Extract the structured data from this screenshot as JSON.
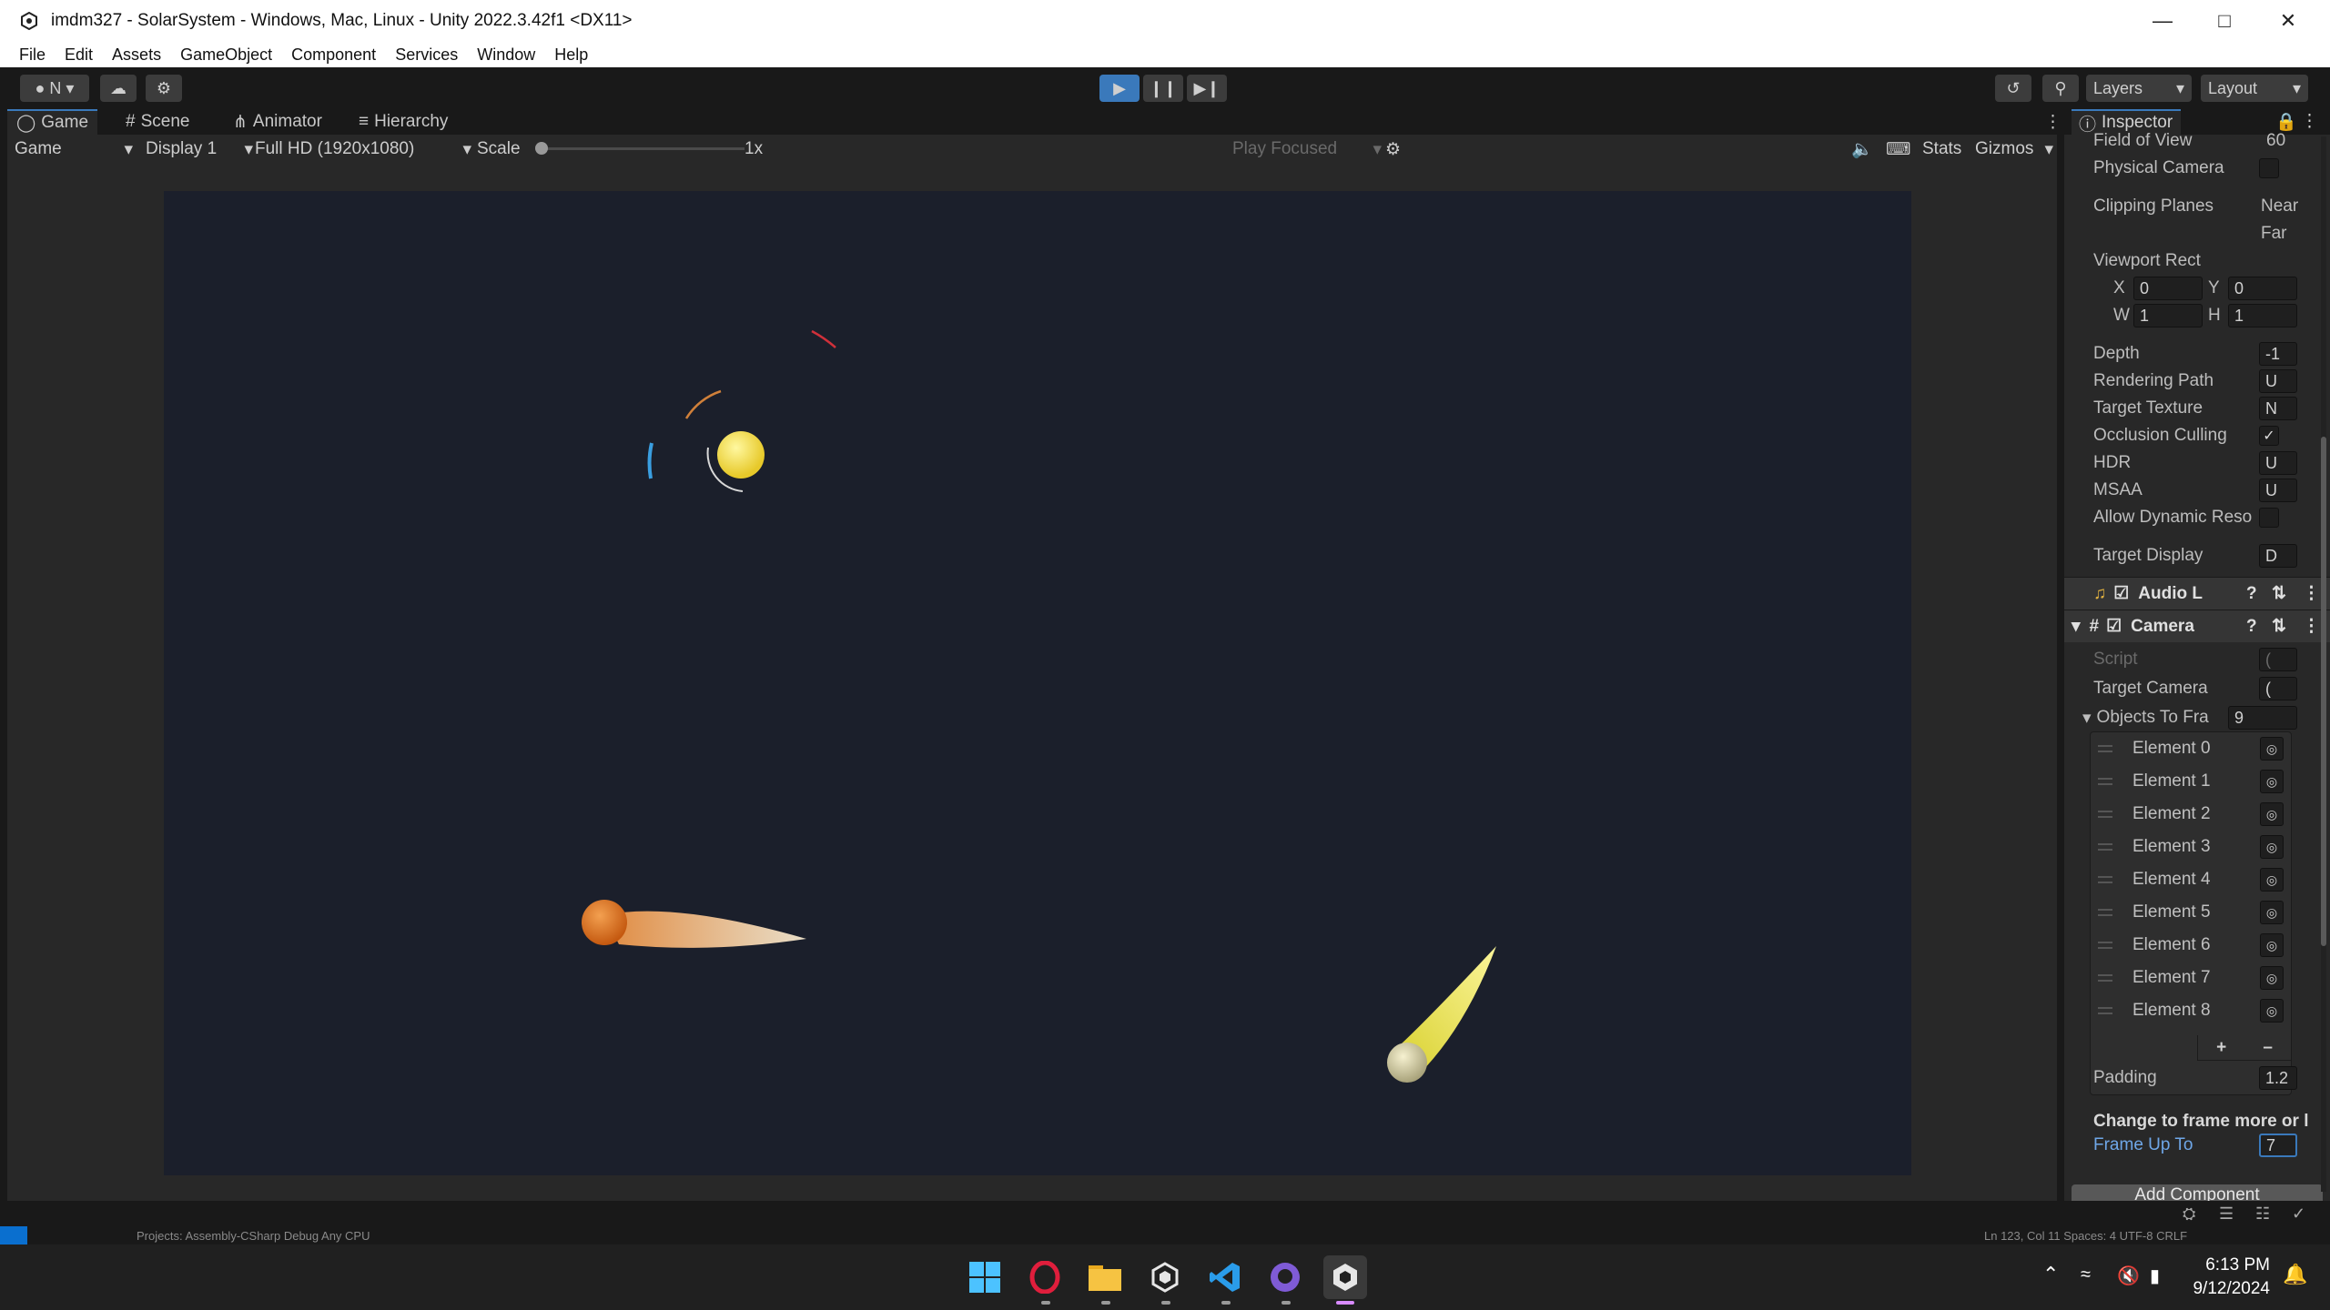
{
  "window": {
    "title": "imdm327 - SolarSystem - Windows, Mac, Linux - Unity 2022.3.42f1 <DX11>"
  },
  "menu": [
    "File",
    "Edit",
    "Assets",
    "GameObject",
    "Component",
    "Services",
    "Window",
    "Help"
  ],
  "toolbar": {
    "account": "N",
    "layers": "Layers",
    "layout": "Layout"
  },
  "tabs": {
    "game": "Game",
    "scene": "Scene",
    "animator": "Animator",
    "hierarchy": "Hierarchy",
    "inspector": "Inspector"
  },
  "gamebar": {
    "mode": "Game",
    "display": "Display 1",
    "resolution": "Full HD (1920x1080)",
    "scale_label": "Scale",
    "scale_value": "1x",
    "play_focused": "Play Focused",
    "stats": "Stats",
    "gizmos": "Gizmos"
  },
  "inspector": {
    "field_of_view_label": "Field of View",
    "field_of_view_value": "60",
    "physical_camera": "Physical Camera",
    "clipping_planes": "Clipping Planes",
    "near": "Near",
    "far": "Far",
    "viewport_rect": "Viewport Rect",
    "x_label": "X",
    "x_value": "0",
    "y_label": "Y",
    "y_value": "0",
    "w_label": "W",
    "w_value": "1",
    "h_label": "H",
    "h_value": "1",
    "depth": "Depth",
    "depth_value": "-1",
    "rendering_path": "Rendering Path",
    "rendering_path_value": "U",
    "target_texture": "Target Texture",
    "target_texture_value": "N",
    "occlusion_culling": "Occlusion Culling",
    "hdr": "HDR",
    "hdr_value": "U",
    "msaa": "MSAA",
    "msaa_value": "U",
    "allow_dynamic": "Allow Dynamic Reso",
    "target_display": "Target Display",
    "target_display_value": "D",
    "audio_component": "Audio L",
    "camera_component": "Camera",
    "script": "Script",
    "script_value": "(",
    "target_camera": "Target Camera",
    "target_camera_value": "(",
    "objects_to_frame": "Objects To Fra",
    "objects_count": "9",
    "elements": [
      "Element 0",
      "Element 1",
      "Element 2",
      "Element 3",
      "Element 4",
      "Element 5",
      "Element 6",
      "Element 7",
      "Element 8"
    ],
    "padding": "Padding",
    "padding_value": "1.2",
    "help_text": "Change to frame more or l",
    "frame_up_to": "Frame Up To",
    "frame_up_to_value": "7",
    "add_component": "Add Component"
  },
  "statusbar": {
    "text": "Projects: Assembly-CSharp   Debug Any CPU",
    "right": "Ln 123, Col 11   Spaces: 4   UTF-8   CRLF"
  },
  "clock": {
    "time": "6:13 PM",
    "date": "9/12/2024"
  },
  "colors": {
    "game_bg": "#1b1f2b",
    "sun": "#f2dc3a",
    "planet_orange": "#e07a20",
    "editor_bg": "#282828"
  }
}
